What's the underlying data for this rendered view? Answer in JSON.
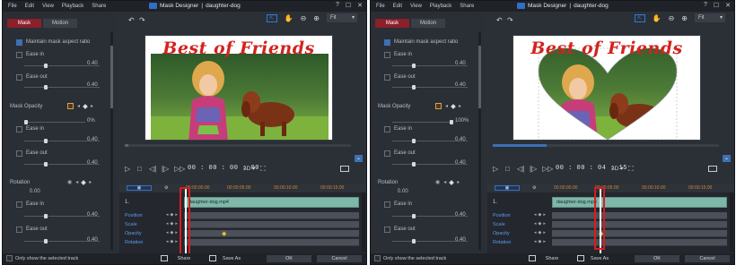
{
  "menu": [
    "File",
    "Edit",
    "View",
    "Playback",
    "Share"
  ],
  "window": {
    "app_name": "Mask Designer",
    "separator": "|",
    "document": "daughter-dog",
    "help": "?",
    "restore": "☐",
    "close": "✕"
  },
  "tabs": [
    "Mask",
    "Motion"
  ],
  "fit_label": "Fit",
  "banner": "Best of Friends",
  "timeline": {
    "ruler": [
      "00:00:00:00",
      "00:00:05:00",
      "00:00:10:00",
      "00:00:15:00"
    ],
    "track_label": "1.",
    "clip_name": "daughter-dog.mp4",
    "properties": [
      "Position",
      "Scale",
      "Opacity",
      "Rotation"
    ]
  },
  "statusbar": {
    "only_show_selected": "Only show the selected track",
    "share": "Share",
    "save_as": "Save As",
    "ok": "OK",
    "cancel": "Cancel"
  },
  "panels": [
    {
      "maintain_aspect": "Maintain mask aspect ratio",
      "ease_in": "Ease in",
      "ease_out": "Ease out",
      "val_040": "0.40",
      "mask_opacity": "Mask Opacity",
      "opacity_value": "0%",
      "rotation": "Rotation",
      "rotation_value": "0.00",
      "timecode": "00 : 00 : 00 : 00",
      "three_d": "3D ▾"
    },
    {
      "maintain_aspect": "Maintain mask aspect ratio",
      "ease_in": "Ease in",
      "ease_out": "Ease out",
      "val_040": "0.40",
      "mask_opacity": "Mask Opacity",
      "opacity_value": "100%",
      "rotation": "Rotation",
      "rotation_value": "0.00",
      "timecode": "00 : 00 : 04 : 15",
      "three_d": "3D ▾"
    }
  ],
  "colors": {
    "accent_blue": "#2f7ad8",
    "tab_active": "#8b1f2a",
    "highlight_red": "#d91c1c",
    "banner_red": "#d1231f",
    "clip_teal": "#7fb7a9"
  }
}
